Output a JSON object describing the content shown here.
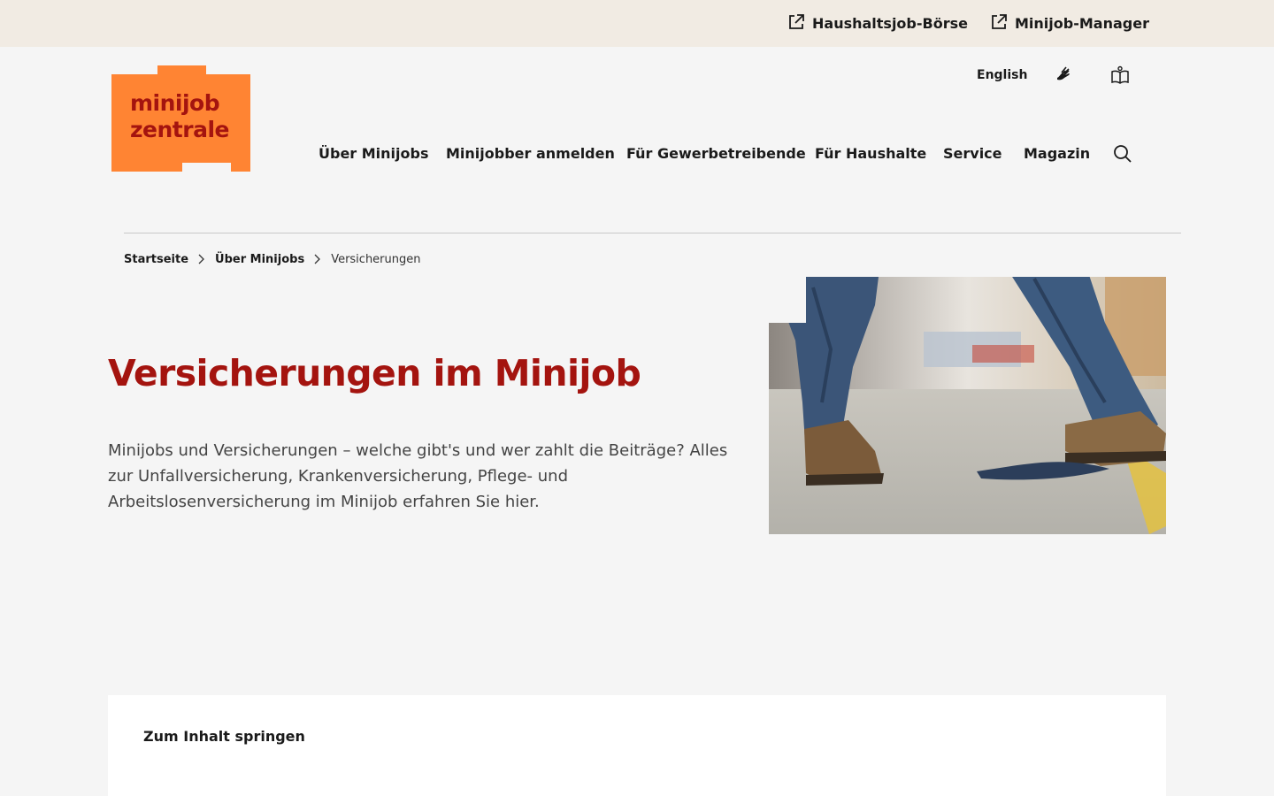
{
  "topbar": {
    "links": [
      {
        "label": "Haushaltsjob-Börse",
        "icon": "external-link-icon"
      },
      {
        "label": "Minijob-Manager",
        "icon": "external-link-icon"
      }
    ]
  },
  "logo": {
    "line1": "minijob",
    "line2": "zentrale",
    "color": "#ff8433",
    "text_color": "#a4140f"
  },
  "utility": {
    "english_label": "English",
    "sign_language_icon": "sign-language-icon",
    "easy_language_icon": "easy-language-book-icon"
  },
  "nav": {
    "items": [
      "Über Minijobs",
      "Minijobber anmelden",
      "Für Gewerbetreibende",
      "Für Haushalte",
      "Service",
      "Magazin"
    ],
    "search_icon": "search-icon"
  },
  "breadcrumb": {
    "items": [
      "Startseite",
      "Über Minijobs"
    ],
    "current": "Versicherungen"
  },
  "page": {
    "title": "Versicherungen im Minijob",
    "intro": "Minijobs und Versicherungen – welche gibt's und wer zahlt die Beiträge? Alles zur Unfallversicherung, Krankenversicherung, Pflege- und Arbeitslosenversicherung im Minijob erfahren Sie hier."
  },
  "skip": {
    "label": "Zum Inhalt springen"
  },
  "colors": {
    "accent": "#a4140f",
    "brand_orange": "#ff8433",
    "topbar_bg": "#f1ebe3",
    "page_bg": "#f5f5f5"
  }
}
